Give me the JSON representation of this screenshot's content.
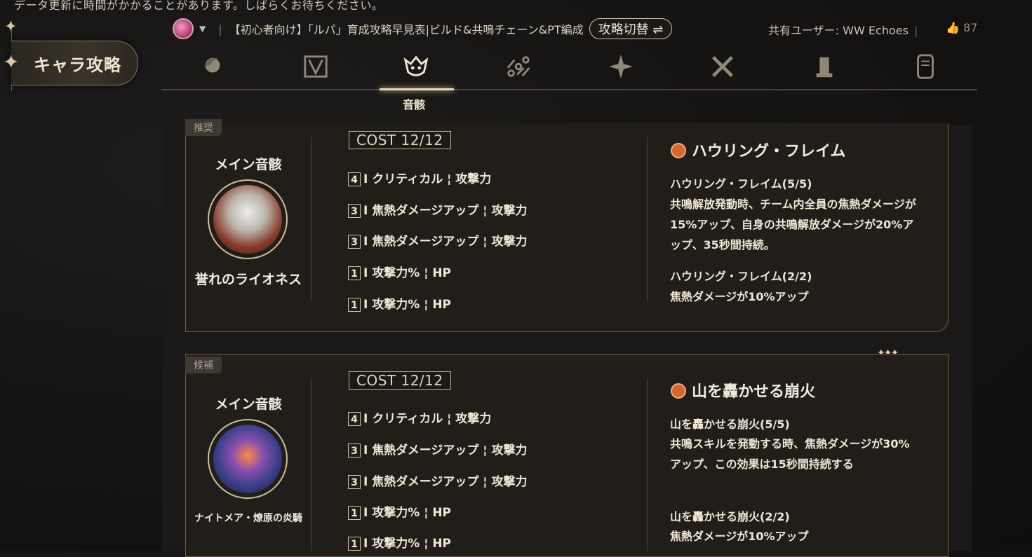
{
  "notice": "データ更新に時間がかかることがあります。しばらくお待ちください。",
  "sidebar": {
    "active_label": "キャラ攻略"
  },
  "header": {
    "guide_title": "【初心者向け】「ルパ」育成攻略早見表|ビルド&共鳴チェーン&PT編成",
    "switch_label": "攻略切替 ⇌",
    "shared_user": "共有ユーザー: WW Echoes",
    "likes": "87"
  },
  "nav": {
    "icons": [
      "character-icon",
      "weapon-frame-icon",
      "echo-icon",
      "chain-icon",
      "star-icon",
      "swords-icon",
      "tower-icon",
      "card-icon"
    ],
    "active_label": "音骸"
  },
  "cards": [
    {
      "tag": "推奨",
      "main_label": "メイン音骸",
      "echo_name": "誉れのライオネス",
      "cost": "COST 12/12",
      "stats": [
        {
          "num": "4",
          "text": "I クリティカル ¦ 攻撃力"
        },
        {
          "num": "3",
          "text": "I 焦熱ダメージアップ ¦ 攻撃力"
        },
        {
          "num": "3",
          "text": "I 焦熱ダメージアップ ¦ 攻撃力"
        },
        {
          "num": "1",
          "text": "I 攻撃力% ¦ HP"
        },
        {
          "num": "1",
          "text": "I 攻撃力% ¦ HP"
        }
      ],
      "set_name": "ハウリング・フレイム",
      "set5_title": "ハウリング・フレイム(5/5)",
      "set5_desc": "共鳴解放発動時、チーム内全員の焦熱ダメージが15%アップ、自身の共鳴解放ダメージが20%アップ、35秒間持続。",
      "set2_title": "ハウリング・フレイム(2/2)",
      "set2_desc": "焦熱ダメージが10%アップ"
    },
    {
      "tag": "候補",
      "main_label": "メイン音骸",
      "echo_name": "ナイトメア・燎原の炎騎",
      "cost": "COST 12/12",
      "stats": [
        {
          "num": "4",
          "text": "I クリティカル ¦ 攻撃力"
        },
        {
          "num": "3",
          "text": "I 焦熱ダメージアップ ¦ 攻撃力"
        },
        {
          "num": "3",
          "text": "I 焦熱ダメージアップ ¦ 攻撃力"
        },
        {
          "num": "1",
          "text": "I 攻撃力% ¦ HP"
        },
        {
          "num": "1",
          "text": "I 攻撃力% ¦ HP"
        }
      ],
      "set_name": "山を轟かせる崩火",
      "set5_title": "山を轟かせる崩火(5/5)",
      "set5_desc": "共鳴スキルを発動する時、焦熱ダメージが30%アップ、この効果は15秒間持続する",
      "set2_title": "山を轟かせる崩火(2/2)",
      "set2_desc": "焦熱ダメージが10%アップ"
    }
  ]
}
